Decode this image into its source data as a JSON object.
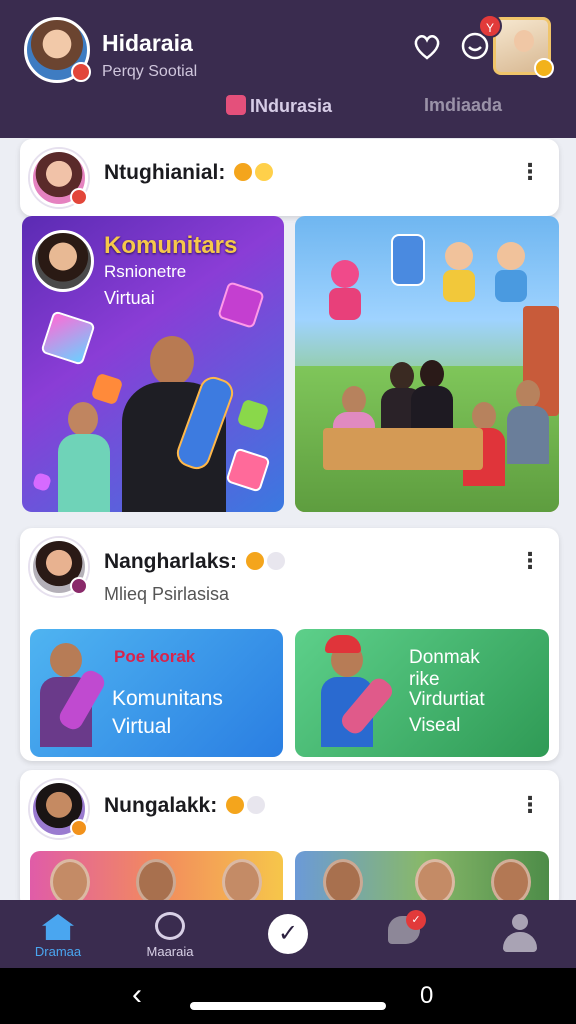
{
  "header": {
    "title": "Hidaraia",
    "subtitle": "Perqy Sootial",
    "notification_count": "Y",
    "tabs": [
      {
        "label": "INdurasia"
      },
      {
        "label": "Imdiaada"
      }
    ]
  },
  "feed": {
    "posts": [
      {
        "name": "Ntughianial:",
        "tile1": {
          "title": "Komunitars",
          "line2": "Rsnionetre",
          "line3": "Virtuai"
        }
      },
      {
        "name": "Nangharlaks:",
        "subtitle": "Mlieq Psirlasisa",
        "tile1": {
          "title": "Poe korak",
          "line2": "Komunitans",
          "line3": "Virtual"
        },
        "tile2": {
          "title": "Donmak",
          "line2": "rike",
          "line3": "Virdurtiat",
          "line4": "Viseal"
        }
      },
      {
        "name": "Nungalakk:"
      }
    ]
  },
  "bottom_nav": {
    "items": [
      {
        "label": "Dramaa",
        "icon": "home-icon"
      },
      {
        "label": "Maaraia",
        "icon": "heart-icon"
      },
      {
        "label": "",
        "icon": "check-icon"
      },
      {
        "label": "",
        "icon": "chat-icon"
      },
      {
        "label": "",
        "icon": "user-icon"
      }
    ],
    "check_glyph": "✓",
    "chat_badge": "✓"
  },
  "system": {
    "back": "‹",
    "recent": "0"
  },
  "colors": {
    "header_bg": "#3a2c4f",
    "accent_blue": "#4aa6f0",
    "badge_red": "#e23a3a"
  }
}
